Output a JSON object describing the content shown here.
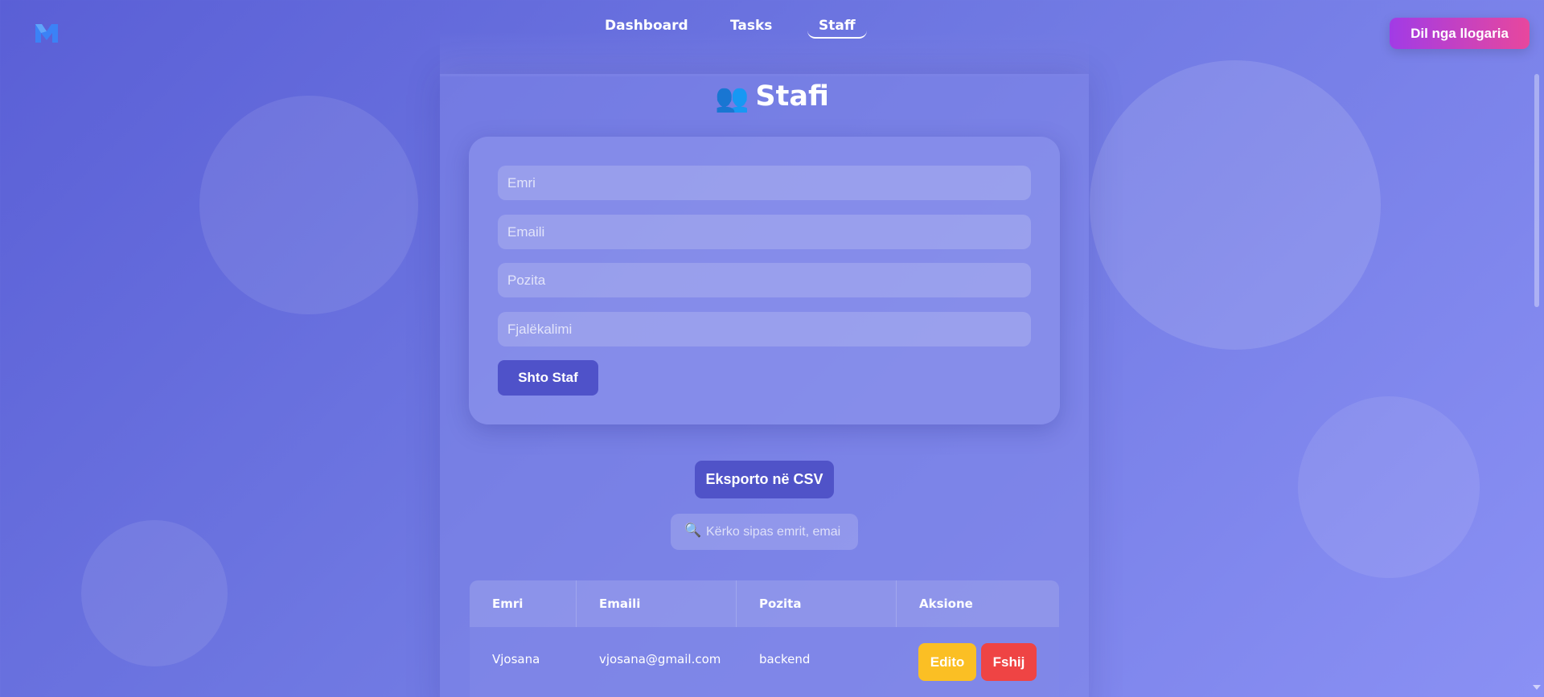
{
  "nav": {
    "links": [
      {
        "label": "Dashboard"
      },
      {
        "label": "Tasks"
      },
      {
        "label": "Staff",
        "active": true
      }
    ],
    "logout_label": "Dil nga llogaria",
    "logo_icon": "m-logo-icon"
  },
  "page": {
    "title": "Stafi",
    "title_icon": "people-icon"
  },
  "form": {
    "name_placeholder": "Emri",
    "email_placeholder": "Emaili",
    "position_placeholder": "Pozita",
    "password_placeholder": "Fjalëkalimi",
    "submit_label": "Shto Staf"
  },
  "export_label": "Eksporto në CSV",
  "search": {
    "placeholder": "Kërko sipas emrit, emai",
    "icon": "magnifier-icon"
  },
  "table": {
    "headers": [
      "Emri",
      "Emaili",
      "Pozita",
      "Aksione"
    ],
    "rows": [
      {
        "name": "Vjosana",
        "email": "vjosana@gmail.com",
        "position": "backend",
        "edit_label": "Edito",
        "delete_label": "Fshij"
      }
    ]
  },
  "colors": {
    "accent": "#5053c8",
    "logout_gradient_start": "#a13be6",
    "logout_gradient_end": "#e8479d",
    "edit": "#fbbf24",
    "delete": "#ef4444"
  }
}
